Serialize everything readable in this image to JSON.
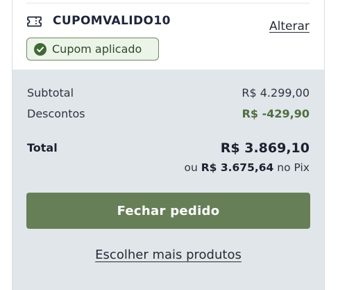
{
  "coupon": {
    "code": "CUPOMVALIDO10",
    "change_label": "Alterar",
    "applied_label": "Cupom aplicado",
    "icon": "ticket-icon",
    "status_icon": "check-circle-icon"
  },
  "summary": {
    "subtotal_label": "Subtotal",
    "subtotal_value": "R$ 4.299,00",
    "discounts_label": "Descontos",
    "discounts_value": "R$ -429,90",
    "total_label": "Total",
    "total_value": "R$ 3.869,10",
    "pix_prefix": "ou",
    "pix_value": "R$ 3.675,64",
    "pix_suffix": "no Pix"
  },
  "actions": {
    "checkout_label": "Fechar pedido",
    "more_products_label": "Escolher mais produtos"
  },
  "colors": {
    "accent": "#677f57",
    "discount": "#4e6f42",
    "summary_bg": "#e1e6ea",
    "badge_bg": "#ecf3e9"
  }
}
